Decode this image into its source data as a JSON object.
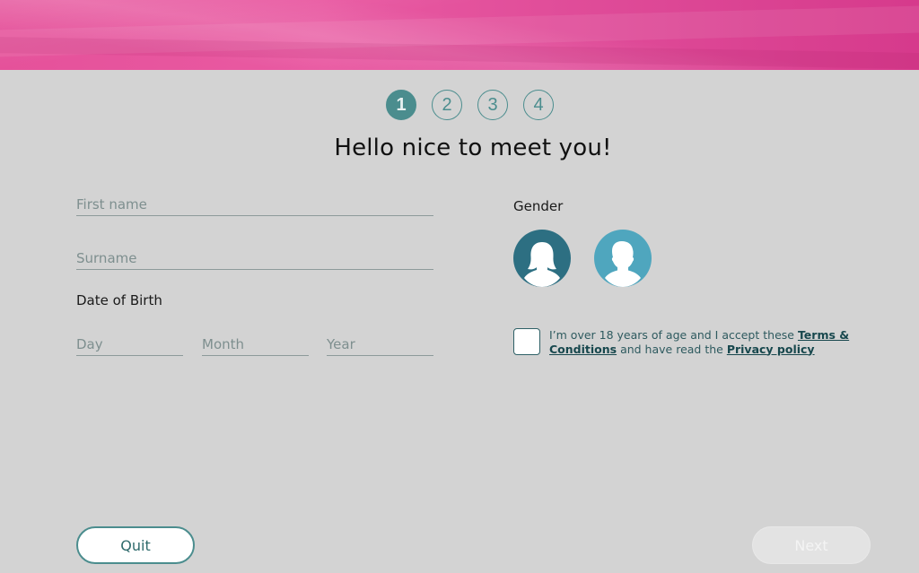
{
  "steps": [
    "1",
    "2",
    "3",
    "4"
  ],
  "active_step": 1,
  "title": "Hello nice to meet you!",
  "form": {
    "first_name": {
      "placeholder": "First name",
      "value": ""
    },
    "surname": {
      "placeholder": "Surname",
      "value": ""
    },
    "dob_label": "Date of Birth",
    "day": {
      "placeholder": "Day",
      "value": ""
    },
    "month": {
      "placeholder": "Month",
      "value": ""
    },
    "year": {
      "placeholder": "Year",
      "value": ""
    },
    "gender_label": "Gender",
    "gender_options": [
      {
        "name": "female",
        "icon": "female-avatar-icon",
        "color": "#2d6f82"
      },
      {
        "name": "male",
        "icon": "male-avatar-icon",
        "color": "#4fa6be"
      }
    ],
    "consent": {
      "checked": false,
      "text_1": "I’m over 18 years of age and I accept these ",
      "terms_link": "Terms & Conditions",
      "text_2": " and have read the ",
      "privacy_link": "Privacy policy"
    }
  },
  "buttons": {
    "quit": "Quit",
    "next": "Next"
  },
  "colors": {
    "accent": "#4b8d8e",
    "banner": "#e5519a",
    "background": "#d3d3d3"
  }
}
